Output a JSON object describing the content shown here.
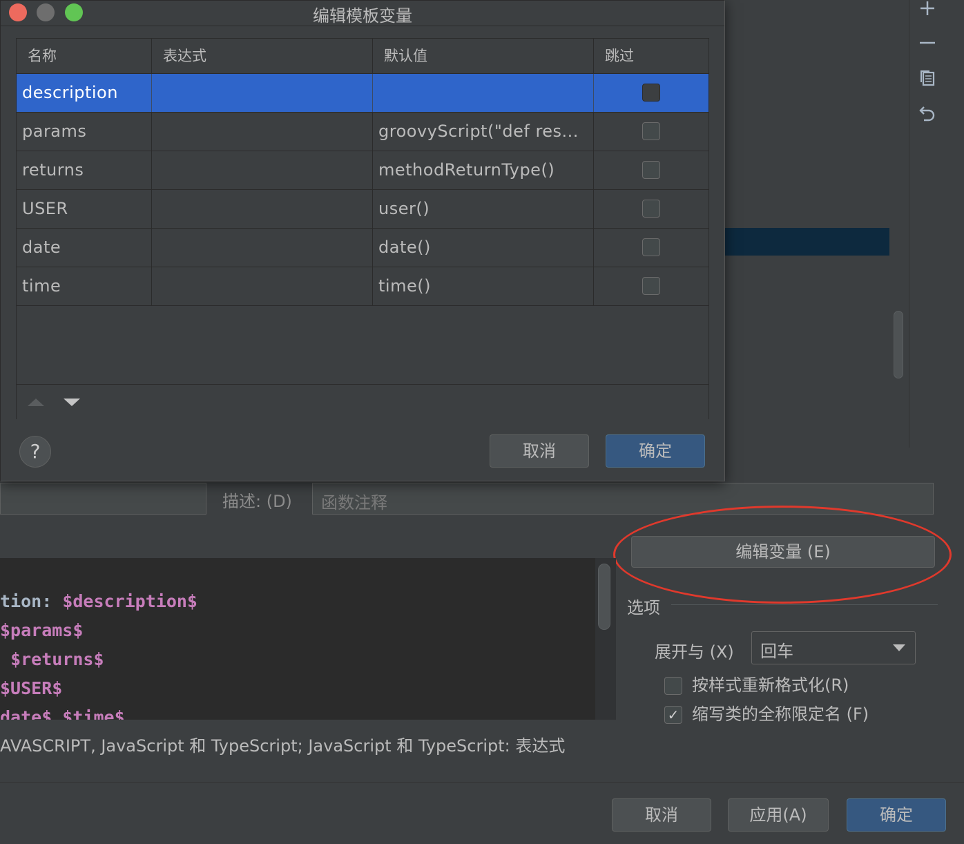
{
  "dialog": {
    "title": "编辑模板变量",
    "columns": [
      "名称",
      "表达式",
      "默认值",
      "跳过"
    ],
    "rows": [
      {
        "name": "description",
        "expression": "",
        "default": "",
        "skip": false,
        "selected": true
      },
      {
        "name": "params",
        "expression": "",
        "default": "groovyScript(\"def res...",
        "skip": false,
        "selected": false
      },
      {
        "name": "returns",
        "expression": "",
        "default": "methodReturnType()",
        "skip": false,
        "selected": false
      },
      {
        "name": "USER",
        "expression": "",
        "default": "user()",
        "skip": false,
        "selected": false
      },
      {
        "name": "date",
        "expression": "",
        "default": "date()",
        "skip": false,
        "selected": false
      },
      {
        "name": "time",
        "expression": "",
        "default": "time()",
        "skip": false,
        "selected": false
      }
    ],
    "help_glyph": "?",
    "cancel_label": "取消",
    "ok_label": "确定"
  },
  "template": {
    "description_label": "描述: (D)",
    "description_value": "函数注释",
    "edit_variables_label": "编辑变量 (E)",
    "editor_lines": [
      {
        "plain": "tion: ",
        "var": "$description$"
      },
      {
        "plain": "",
        "var": "$params$"
      },
      {
        "plain": " ",
        "var": "$returns$"
      },
      {
        "plain": "",
        "var": "$USER$"
      },
      {
        "plain": "",
        "var": "date$ $time$"
      }
    ],
    "context_text": "AVASCRIPT, JavaScript 和 TypeScript; JavaScript 和 TypeScript: 表达式"
  },
  "options": {
    "title": "选项",
    "expand_label": "展开与 (X)",
    "expand_value": "回车",
    "reformat_label": "按样式重新格式化(R)",
    "reformat_checked": false,
    "shorten_label": "缩写类的全称限定名 (F)",
    "shorten_checked": true,
    "check_glyph": "✓"
  },
  "toolbar_icons": [
    "plus-icon",
    "minus-icon",
    "copy-icon",
    "undo-icon"
  ],
  "footer": {
    "cancel_label": "取消",
    "apply_label": "应用(A)",
    "ok_label": "确定"
  },
  "colors": {
    "selection": "#2f65ca",
    "default_button": "#365880",
    "template_variable": "#c77dbb",
    "annotation": "#e0392c"
  }
}
